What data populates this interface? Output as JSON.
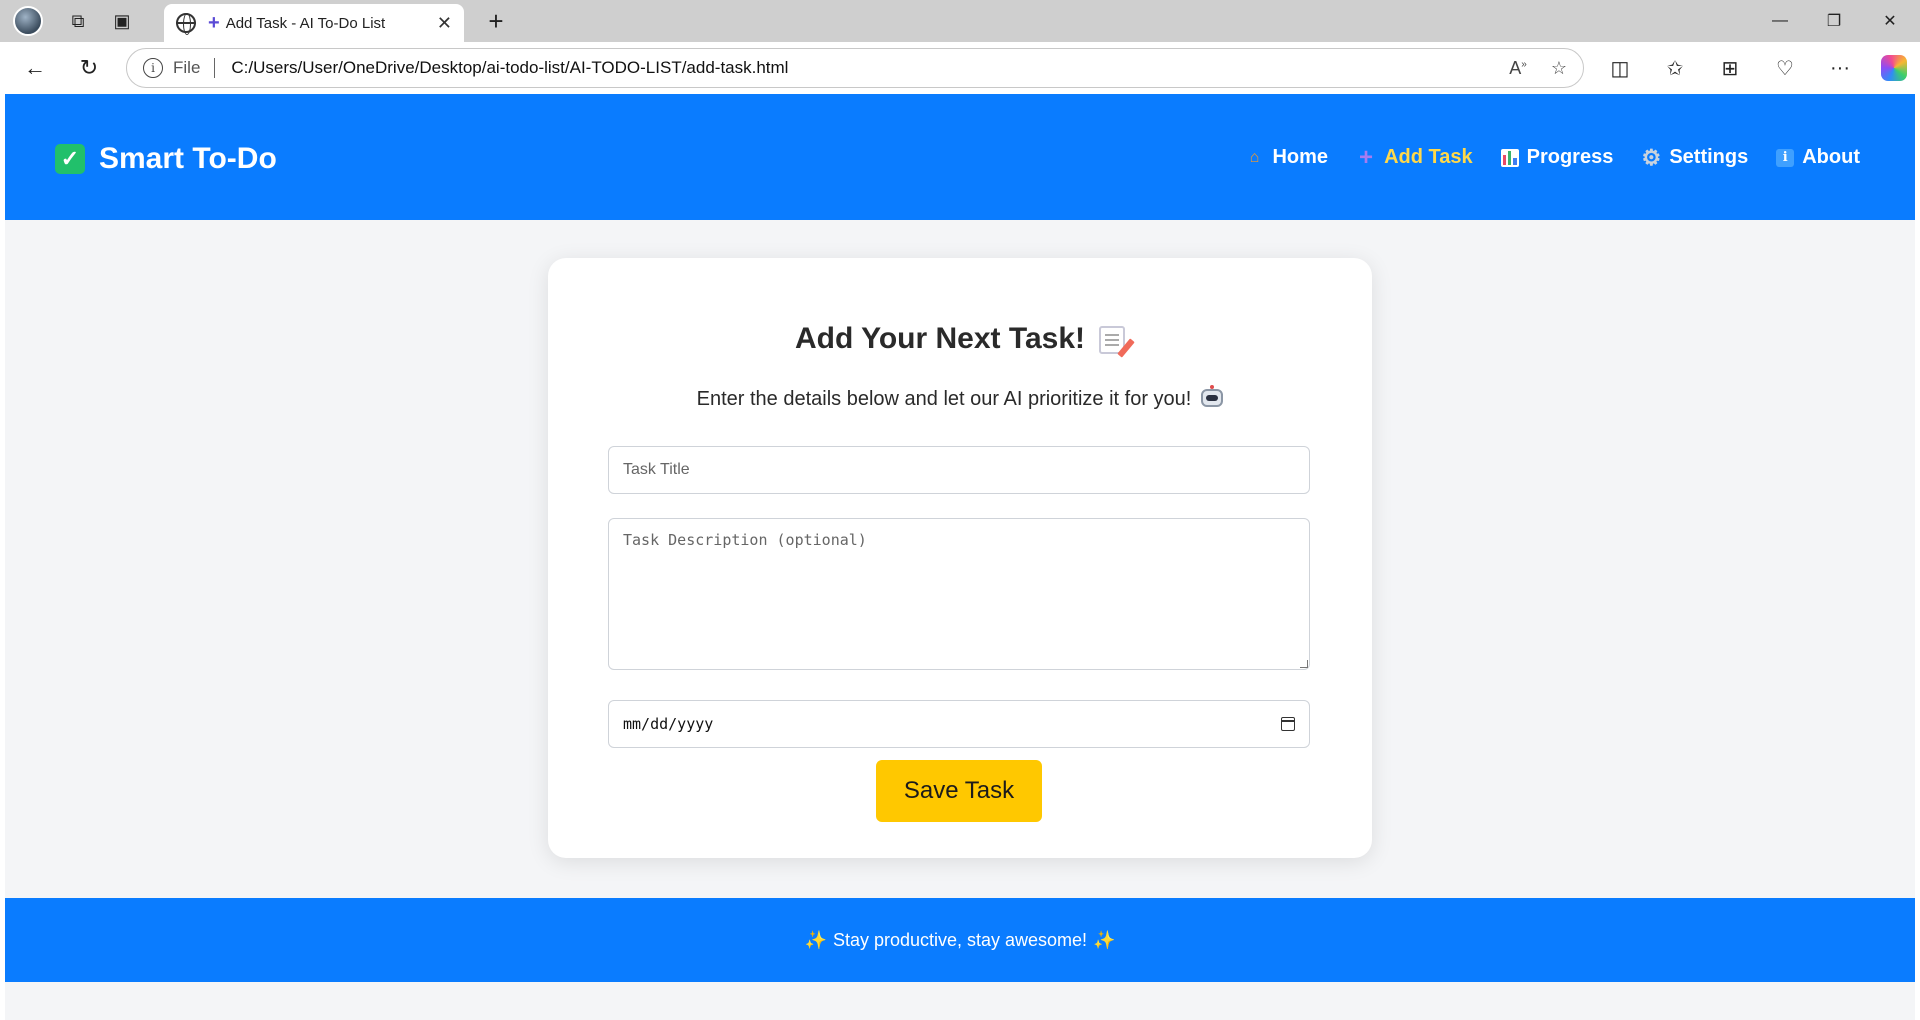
{
  "browser": {
    "tab_title": "Add Task - AI To-Do List",
    "address_scheme": "File",
    "url": "C:/Users/User/OneDrive/Desktop/ai-todo-list/AI-TODO-LIST/add-task.html"
  },
  "header": {
    "logo_text": "Smart To-Do",
    "nav": [
      {
        "label": "Home",
        "icon": "house-icon"
      },
      {
        "label": "Add Task",
        "icon": "plus-icon",
        "active": true
      },
      {
        "label": "Progress",
        "icon": "bar-chart-icon"
      },
      {
        "label": "Settings",
        "icon": "gear-icon"
      },
      {
        "label": "About",
        "icon": "info-icon"
      }
    ]
  },
  "form": {
    "title": "Add Your Next Task!",
    "subtitle": "Enter the details below and let our AI prioritize it for you!",
    "task_title_placeholder": "Task Title",
    "task_description_placeholder": "Task Description (optional)",
    "date_placeholder": "mm/dd/yyyy",
    "save_label": "Save Task"
  },
  "footer": {
    "text": "Stay productive, stay awesome!"
  },
  "colors": {
    "brand_blue": "#0a7cff",
    "active_nav": "#ffd84a",
    "save_button": "#ffc800",
    "logo_check": "#21c06b"
  }
}
